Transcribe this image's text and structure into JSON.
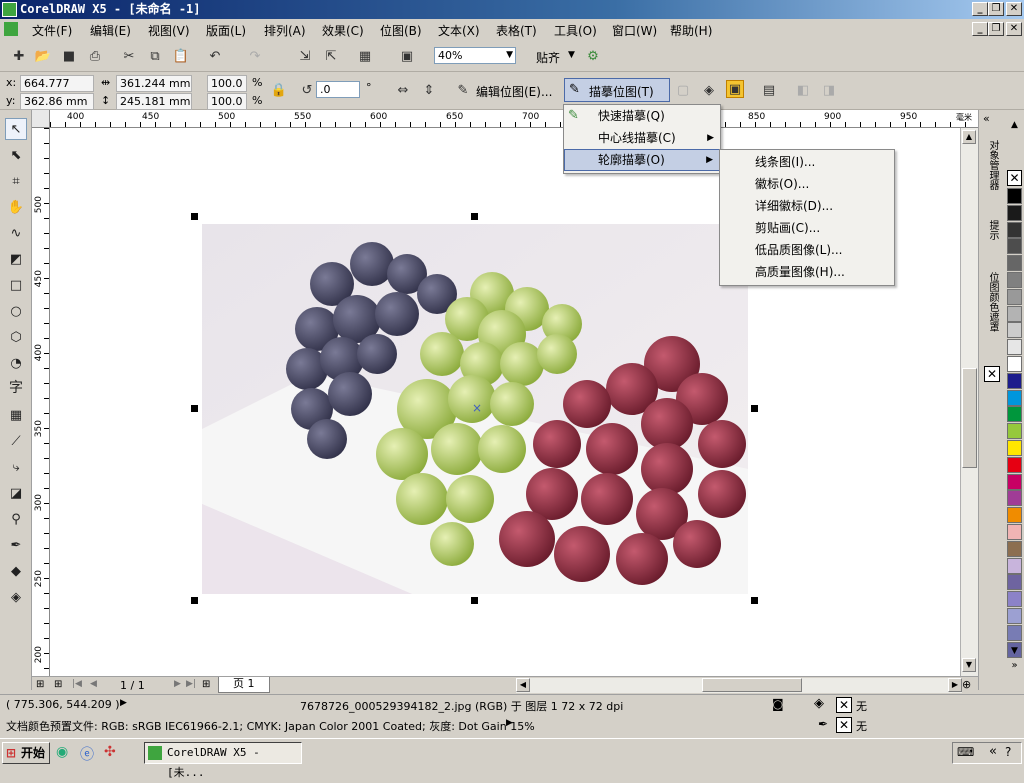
{
  "window": {
    "title": "CorelDRAW X5 - [未命名 -1]",
    "min": "_",
    "restore": "❐",
    "close": "✕"
  },
  "menubar": [
    {
      "label": "文件(F)"
    },
    {
      "label": "编辑(E)"
    },
    {
      "label": "视图(V)"
    },
    {
      "label": "版面(L)"
    },
    {
      "label": "排列(A)"
    },
    {
      "label": "效果(C)"
    },
    {
      "label": "位图(B)"
    },
    {
      "label": "文本(X)"
    },
    {
      "label": "表格(T)"
    },
    {
      "label": "工具(O)"
    },
    {
      "label": "窗口(W)"
    },
    {
      "label": "帮助(H)"
    }
  ],
  "standard_toolbar": {
    "zoom": "40%",
    "snap": "贴齐"
  },
  "property_bar": {
    "x_label": "x:",
    "x_value": "664.777 mm",
    "y_label": "y:",
    "y_value": "362.86 mm",
    "width_value": "361.244 mm",
    "height_value": "245.181 mm",
    "scale_x": "100.0",
    "scale_y": "100.0",
    "percent": "%",
    "rotation": ".0",
    "degree": "°",
    "edit_bitmap": "编辑位图(E)...",
    "trace_bitmap": "描摹位图(T)"
  },
  "hruler_ticks": [
    "400",
    "450",
    "500",
    "550",
    "600",
    "650",
    "700",
    "850",
    "900",
    "950"
  ],
  "hruler_unit": "毫米",
  "vruler_ticks": [
    "500",
    "450",
    "400",
    "350",
    "300",
    "250",
    "200"
  ],
  "trace_menu": {
    "items": [
      "快速描摹(Q)",
      "中心线描摹(C)",
      "轮廓描摹(O)"
    ]
  },
  "outline_submenu": {
    "items": [
      "线条图(I)...",
      "徽标(O)...",
      "详细徽标(D)...",
      "剪贴画(C)...",
      "低品质图像(L)...",
      "高质量图像(H)..."
    ]
  },
  "page_nav": {
    "counter": "1 / 1",
    "tab": "页 1"
  },
  "docker_tabs": [
    "对象管理器",
    "提示",
    "位图颜色遮罩"
  ],
  "palette_colors": [
    "#000000",
    "#1a1a1a",
    "#333333",
    "#4d4d4d",
    "#666666",
    "#808080",
    "#999999",
    "#b3b3b3",
    "#cccccc",
    "#e6e6e6",
    "#ffffff",
    "#1c1c8c",
    "#0096dc",
    "#00963c",
    "#96c83c",
    "#ffe600",
    "#e60012",
    "#c80064",
    "#a03c96",
    "#f08c00",
    "#f0b4b4",
    "#8c6e50",
    "#c8b4dc",
    "#6e64a0",
    "#8c82c8",
    "#9ca0d2",
    "#787cb4",
    "#6464a0"
  ],
  "status": {
    "coords": "( 775.306, 544.209 )",
    "object_info": "7678726_000529394182_2.jpg (RGB) 于 图层 1 72 x 72 dpi",
    "color_profile": "文档颜色预置文件: RGB: sRGB IEC61966-2.1; CMYK: Japan Color 2001 Coated; 灰度: Dot Gain 15%",
    "fill_none": "无",
    "outline_none": "无"
  },
  "taskbar": {
    "start": "开始",
    "task": "CorelDRAW X5 - [未..."
  }
}
